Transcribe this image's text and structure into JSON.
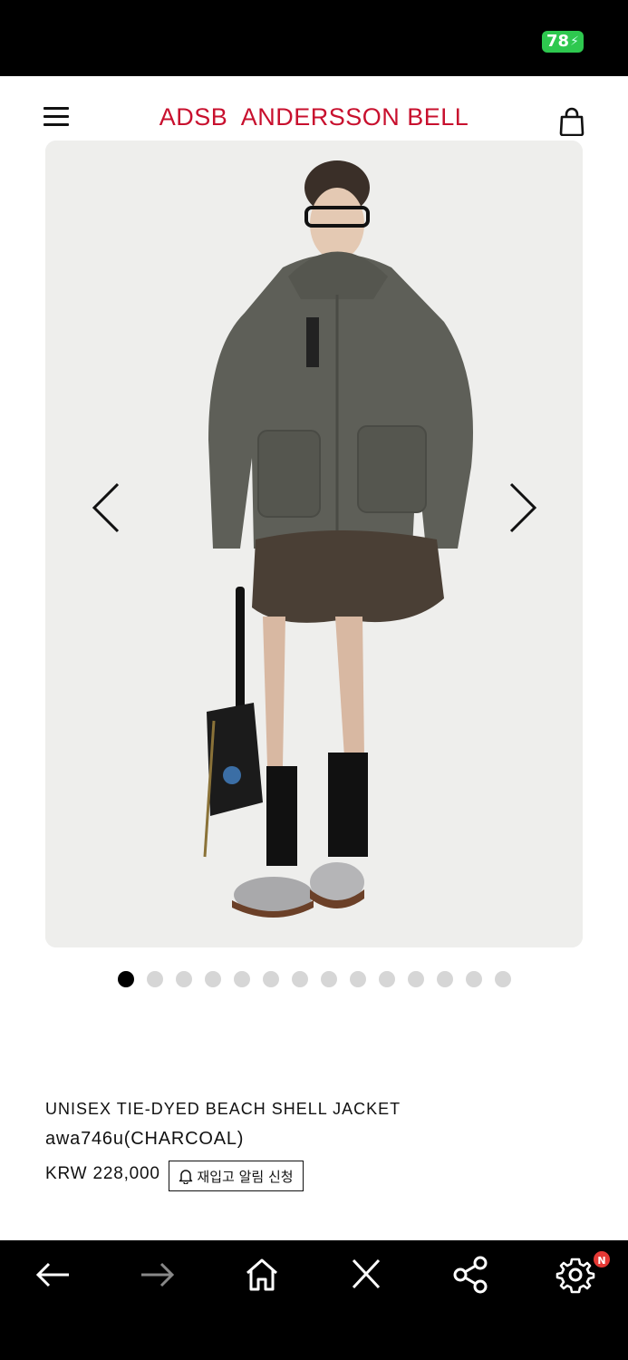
{
  "status_bar": {
    "battery": "78"
  },
  "header": {
    "logo": "ADSB  ANDERSSON BELL"
  },
  "carousel": {
    "total_slides": 14,
    "active_index": 0
  },
  "product": {
    "name": "UNISEX TIE-DYED BEACH SHELL JACKET",
    "code": "awa746u(CHARCOAL)",
    "price": "KRW 228,000",
    "restock_label": "재입고 알림 신청"
  },
  "bottom_nav": {
    "items": [
      "back-icon",
      "forward-icon",
      "home-icon",
      "close-icon",
      "share-icon",
      "settings-icon"
    ],
    "settings_badge": "N"
  },
  "colors": {
    "brand": "#c8102e",
    "battery": "#2ec84f",
    "badge": "#e53935"
  }
}
